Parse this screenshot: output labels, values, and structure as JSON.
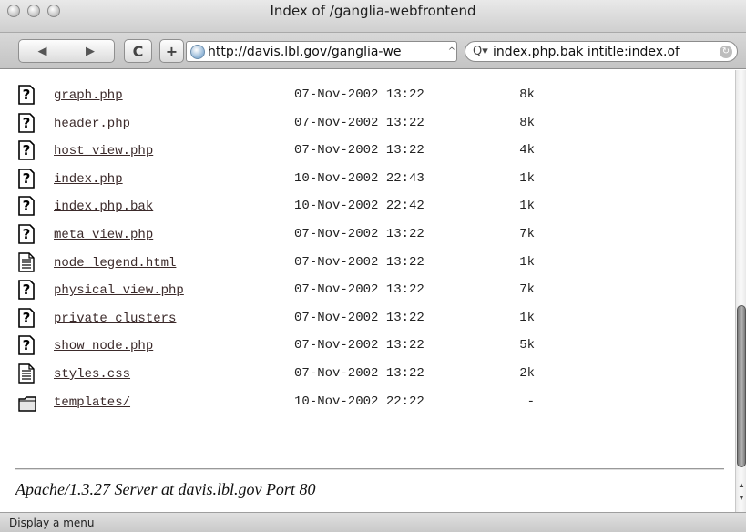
{
  "window": {
    "title": "Index of /ganglia-webfrontend"
  },
  "toolbar": {
    "back_icon": "back-arrow-icon",
    "forward_icon": "forward-arrow-icon",
    "reload_label": "C",
    "add_bookmark_label": "+",
    "url": "http://davis.lbl.gov/ganglia-we",
    "search_query": "index.php.bak intitle:index.of"
  },
  "listing": {
    "rows": [
      {
        "name": "graph.php",
        "date": "07-Nov-2002 13:22",
        "size": "8k",
        "icon": "unknown-file-icon"
      },
      {
        "name": "header.php",
        "date": "07-Nov-2002 13:22",
        "size": "8k",
        "icon": "unknown-file-icon"
      },
      {
        "name": "host_view.php",
        "date": "07-Nov-2002 13:22",
        "size": "4k",
        "icon": "unknown-file-icon"
      },
      {
        "name": "index.php",
        "date": "10-Nov-2002 22:43",
        "size": "1k",
        "icon": "unknown-file-icon"
      },
      {
        "name": "index.php.bak",
        "date": "10-Nov-2002 22:42",
        "size": "1k",
        "icon": "unknown-file-icon"
      },
      {
        "name": "meta_view.php",
        "date": "07-Nov-2002 13:22",
        "size": "7k",
        "icon": "unknown-file-icon"
      },
      {
        "name": "node_legend.html",
        "date": "07-Nov-2002 13:22",
        "size": "1k",
        "icon": "text-file-icon"
      },
      {
        "name": "physical_view.php",
        "date": "07-Nov-2002 13:22",
        "size": "7k",
        "icon": "unknown-file-icon"
      },
      {
        "name": "private_clusters",
        "date": "07-Nov-2002 13:22",
        "size": "1k",
        "icon": "unknown-file-icon"
      },
      {
        "name": "show_node.php",
        "date": "07-Nov-2002 13:22",
        "size": "5k",
        "icon": "unknown-file-icon"
      },
      {
        "name": "styles.css",
        "date": "07-Nov-2002 13:22",
        "size": "2k",
        "icon": "text-file-icon"
      },
      {
        "name": "templates/",
        "date": "10-Nov-2002 22:22",
        "size": "-",
        "icon": "folder-icon"
      }
    ]
  },
  "footer": {
    "server_signature": "Apache/1.3.27 Server at davis.lbl.gov Port 80"
  },
  "status": {
    "text": "Display a menu"
  },
  "colors": {
    "link": "#3b2a2a",
    "chrome_light": "#e9e9e9",
    "chrome_dark": "#c4c4c4"
  }
}
